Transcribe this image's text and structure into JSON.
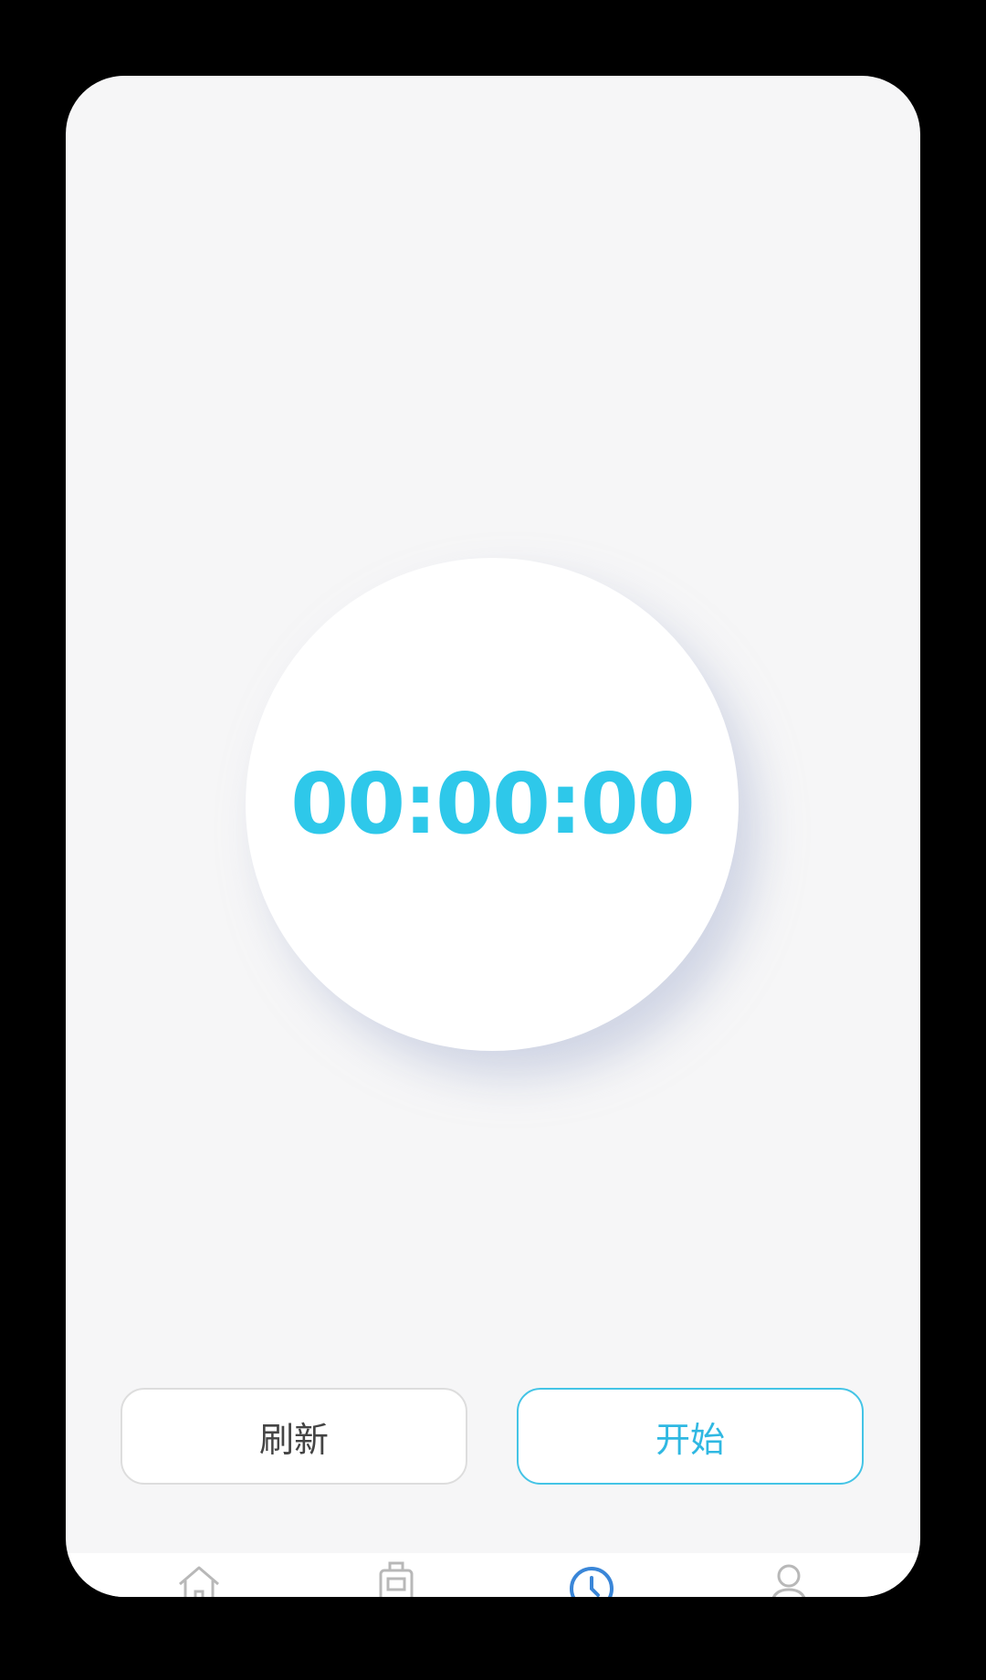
{
  "timer": {
    "display": "00:00:00"
  },
  "actions": {
    "refresh_label": "刷新",
    "start_label": "开始"
  },
  "tabbar": {
    "items": [
      {
        "icon": "home-icon",
        "active": false
      },
      {
        "icon": "briefcase-icon",
        "active": false
      },
      {
        "icon": "clock-icon",
        "active": true
      },
      {
        "icon": "user-icon",
        "active": false
      }
    ]
  },
  "colors": {
    "accent": "#2ec8ea",
    "active_tab": "#3a86d8",
    "inactive_tab": "#b8b8b8",
    "background": "#f6f6f7"
  }
}
